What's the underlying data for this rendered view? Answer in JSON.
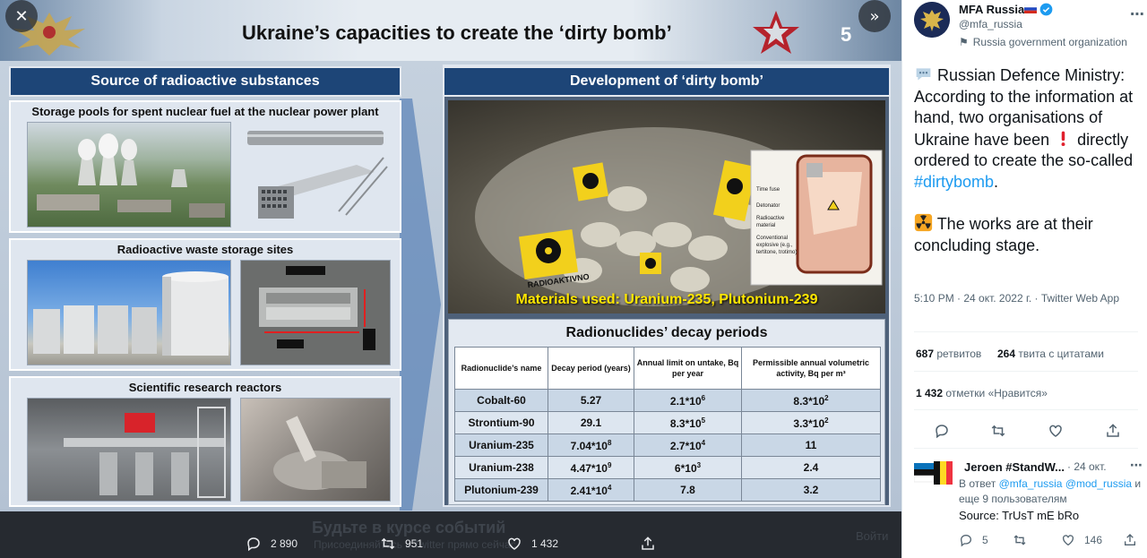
{
  "slide": {
    "title": "Ukraine’s capacities to create the ‘dirty bomb’",
    "number": "5",
    "left_heading": "Source of radioactive substances",
    "right_heading": "Development of ‘dirty bomb’",
    "panels": [
      {
        "caption": "Storage pools for spent nuclear fuel at the nuclear power plant"
      },
      {
        "caption": "Radioactive waste storage sites"
      },
      {
        "caption": "Scientific research reactors"
      }
    ],
    "materials": "Materials used: Uranium-235, Plutonium-239",
    "diagram_labels": [
      "Time fuse",
      "Detonator",
      "Radioactive material",
      "Conventional explosive (e.g., tertitone, trotimo)"
    ],
    "bag_label": "RADIOAKTIVNO",
    "decay_title": "Radionuclides’ decay periods",
    "decay_headers": [
      "Radionuclide’s name",
      "Decay period (years)",
      "Annual limit on untake, Bq per year",
      "Permissible annual volumetric activity, Bq per m³"
    ],
    "decay_rows": [
      {
        "name": "Cobalt-60",
        "period": "5.27",
        "limit_base": "2.1*10",
        "limit_exp": "6",
        "activity_base": "8.3*10",
        "activity_exp": "2"
      },
      {
        "name": "Strontium-90",
        "period": "29.1",
        "limit_base": "8.3*10",
        "limit_exp": "5",
        "activity_base": "3.3*10",
        "activity_exp": "2"
      },
      {
        "name": "Uranium-235",
        "period": "7.04*10",
        "period_exp": "8",
        "limit_base": "2.7*10",
        "limit_exp": "4",
        "activity_base": "11",
        "activity_exp": ""
      },
      {
        "name": "Uranium-238",
        "period": "4.47*10",
        "period_exp": "9",
        "limit_base": "6*10",
        "limit_exp": "3",
        "activity_base": "2.4",
        "activity_exp": ""
      },
      {
        "name": "Plutonium-239",
        "period": "2.41*10",
        "period_exp": "4",
        "limit_base": "7.8",
        "limit_exp": "",
        "activity_base": "3.2",
        "activity_exp": ""
      }
    ]
  },
  "viewer": {
    "close_icon": "close-icon",
    "expand_icon": "double-chevron-right-icon",
    "ghost_title": "Будьте в курсе событий",
    "ghost_sub": "Присоединяйтесь к Twitter прямо сейчас",
    "ghost_login": "Войти",
    "replies": "2 890",
    "retweets": "951",
    "likes": "1 432"
  },
  "tweet": {
    "name": "MFA Russia",
    "handle": "@mfa_russia",
    "org": "Russia government organization",
    "text_1": "Russian Defence Ministry: According to the information at hand, two organisations of Ukraine have been",
    "text_2": "directly ordered to create the so-called",
    "hashtag": "#dirtybomb",
    "text_3": ".",
    "text_4": "The works are at their concluding stage.",
    "timestamp": "5:10 PM · 24 окт. 2022 г. · Twitter Web App",
    "retweets_count": "687",
    "retweets_label": "ретвитов",
    "quotes_count": "264",
    "quotes_label": "твита с цитатами",
    "likes_count": "1 432",
    "likes_label": "отметки «Нравится»"
  },
  "reply": {
    "name": "Jeroen #StandW...",
    "date": "· 24 окт.",
    "in_reply": "В ответ",
    "mention_1": "@mfa_russia",
    "mention_2": "@mod_russia",
    "others": "и еще 9 пользователям",
    "text": "Source: TrUsT mE bRo",
    "replies": "5",
    "likes": "146"
  },
  "colors": {
    "accent": "#1d9bf0",
    "banner": "#1d4577",
    "viewer_bg": "#262a30"
  }
}
